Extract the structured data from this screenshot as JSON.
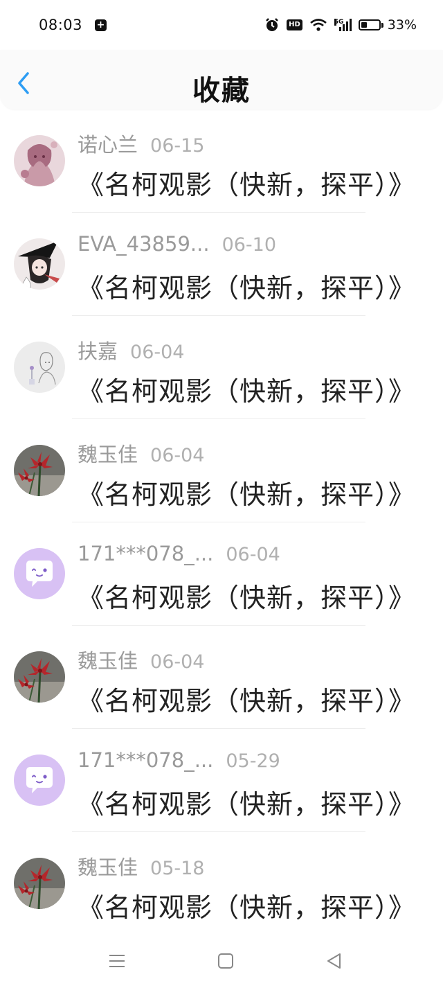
{
  "status_bar": {
    "time": "08:03",
    "network": "5G",
    "battery_percent": "33%",
    "battery_level": 0.33
  },
  "header": {
    "title": "收藏",
    "back_icon": "chevron-left-icon",
    "accent_color": "#2d9df4"
  },
  "items": [
    {
      "user": "诺心兰",
      "date": "06-15",
      "title": "《名柯观影（快新，探平）》",
      "avatar": "anime-girl-pink"
    },
    {
      "user": "EVA_43859...",
      "date": "06-10",
      "title": "《名柯观影（快新，探平）》",
      "avatar": "anime-witch"
    },
    {
      "user": "扶嘉",
      "date": "06-04",
      "title": "《名柯观影（快新，探平）》",
      "avatar": "sketch-girl"
    },
    {
      "user": "魏玉佳",
      "date": "06-04",
      "title": "《名柯观影（快新，探平）》",
      "avatar": "red-flowers"
    },
    {
      "user": "171***078_...",
      "date": "06-04",
      "title": "《名柯观影（快新，探平）》",
      "avatar": "chat-bubble-purple"
    },
    {
      "user": "魏玉佳",
      "date": "06-04",
      "title": "《名柯观影（快新，探平）》",
      "avatar": "red-flowers"
    },
    {
      "user": "171***078_...",
      "date": "05-29",
      "title": "《名柯观影（快新，探平）》",
      "avatar": "chat-bubble-purple"
    },
    {
      "user": "魏玉佳",
      "date": "05-18",
      "title": "《名柯观影（快新，探平）》",
      "avatar": "red-flowers"
    }
  ],
  "nav": {
    "menu_icon": "menu-icon",
    "home_icon": "home-square-icon",
    "back_icon": "back-triangle-icon"
  }
}
